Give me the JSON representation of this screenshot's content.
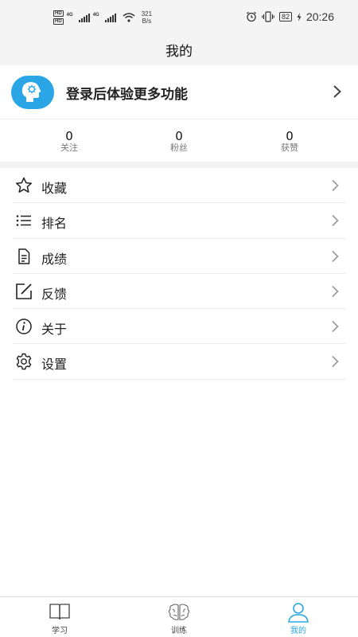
{
  "status_bar": {
    "hd1": "HD",
    "hd2": "HD",
    "sig1_label": "4G",
    "sig2_label": "4G",
    "speed_value": "321",
    "speed_unit": "B/s",
    "battery": "82",
    "time": "20:26"
  },
  "page": {
    "title": "我的"
  },
  "profile": {
    "login_prompt": "登录后体验更多功能"
  },
  "stats": [
    {
      "value": "0",
      "label": "关注"
    },
    {
      "value": "0",
      "label": "粉丝"
    },
    {
      "value": "0",
      "label": "获赞"
    }
  ],
  "menu": [
    {
      "label": "收藏",
      "icon": "star-icon"
    },
    {
      "label": "排名",
      "icon": "list-icon"
    },
    {
      "label": "成绩",
      "icon": "document-icon"
    },
    {
      "label": "反馈",
      "icon": "edit-icon"
    },
    {
      "label": "关于",
      "icon": "info-icon"
    },
    {
      "label": "设置",
      "icon": "gear-icon"
    }
  ],
  "tabs": [
    {
      "label": "学习",
      "icon": "book-icon",
      "active": false
    },
    {
      "label": "训练",
      "icon": "brain-icon",
      "active": false
    },
    {
      "label": "我的",
      "icon": "person-icon",
      "active": true
    }
  ],
  "colors": {
    "accent": "#2aa6e6",
    "header_bg": "#f4f4f4"
  }
}
